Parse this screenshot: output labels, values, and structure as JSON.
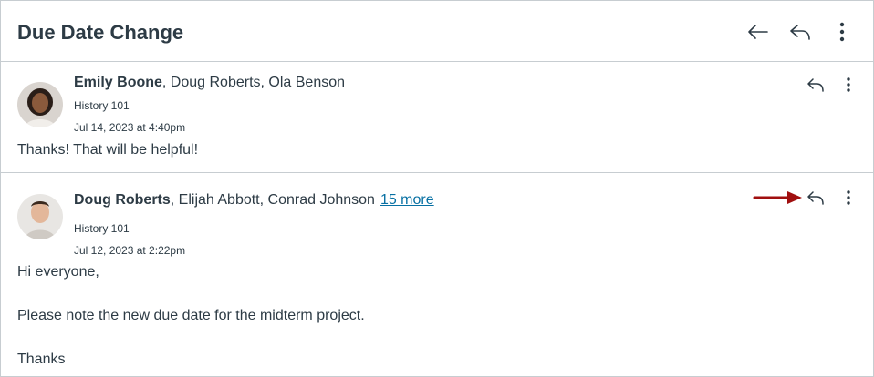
{
  "header": {
    "title": "Due Date Change"
  },
  "messages": [
    {
      "author": "Emily Boone",
      "others": ", Doug Roberts, Ola Benson",
      "more": "",
      "course": "History 101",
      "date": "Jul 14, 2023 at 4:40pm",
      "body": "Thanks! That will be helpful!"
    },
    {
      "author": "Doug Roberts",
      "others": ", Elijah Abbott, Conrad Johnson",
      "more": "15 more",
      "course": "History 101",
      "date": "Jul 12, 2023 at 2:22pm",
      "body_lines": [
        "Hi everyone,",
        "Please note the new due date for the midterm project.",
        "Thanks"
      ]
    }
  ],
  "colors": {
    "text": "#2d3b45",
    "link": "#0770a3",
    "divider": "#c7cdd1",
    "annotation_arrow": "#a00f0f"
  },
  "icons": {
    "back": "arrow-left-icon",
    "reply": "reply-icon",
    "more": "kebab-menu-icon",
    "annotation": "red-arrow-pointer"
  }
}
